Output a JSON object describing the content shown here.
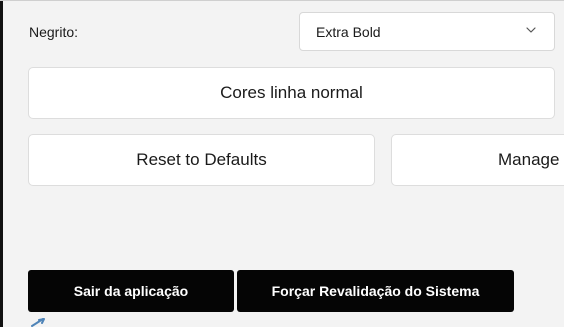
{
  "bold_field": {
    "label": "Negrito:",
    "selected_value": "Extra Bold",
    "dropdown_icon": "chevron-down-icon"
  },
  "buttons": {
    "normal_line_colors": "Cores linha normal",
    "reset_defaults": "Reset to Defaults",
    "manage": "Manage",
    "exit_app": "Sair da aplicação",
    "force_revalidation": "Forçar Revalidação do Sistema"
  },
  "icons": {
    "cursor": "cursor-icon"
  },
  "colors": {
    "background": "#f3f3f3",
    "surface": "#ffffff",
    "dark_button": "#050505",
    "cursor_blue": "#4f84b8"
  }
}
